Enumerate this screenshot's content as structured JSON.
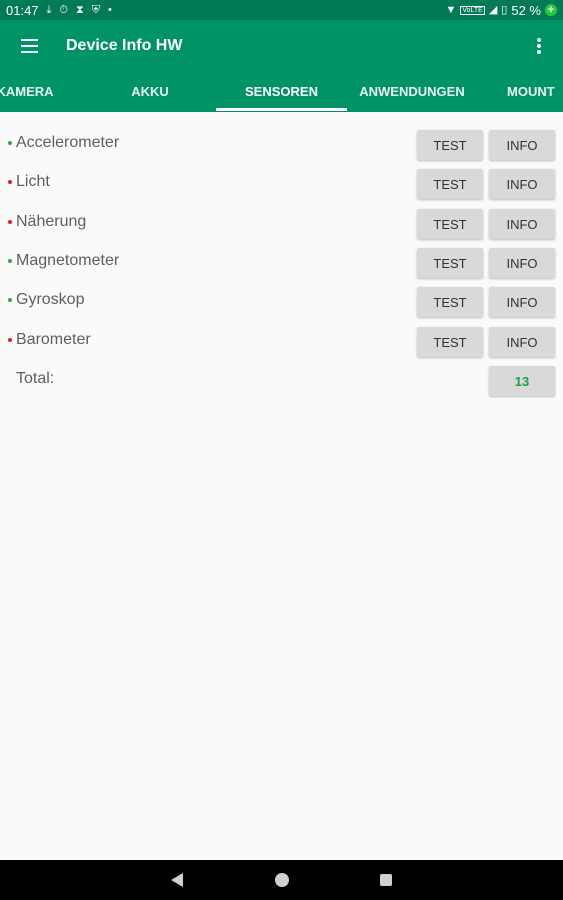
{
  "status_bar": {
    "time": "01:47",
    "left_icons": [
      "download-icon",
      "timer-icon",
      "hourglass-icon",
      "shield-icon",
      "dot-icon"
    ],
    "right_icons": [
      "wifi-icon",
      "volte-icon",
      "signal-icon",
      "battery-icon"
    ],
    "volte_label": "VoLTE",
    "battery": "52 %"
  },
  "app_bar": {
    "title": "Device Info HW"
  },
  "tabs": [
    {
      "label": "KAMERA",
      "active": false
    },
    {
      "label": "AKKU",
      "active": false
    },
    {
      "label": "SENSOREN",
      "active": true
    },
    {
      "label": "ANWENDUNGEN",
      "active": false
    },
    {
      "label": "MOUNT",
      "active": false
    }
  ],
  "sensors": [
    {
      "name": "Accelerometer",
      "dot_color": "#2eaa4a",
      "test_label": "TEST",
      "info_label": "INFO"
    },
    {
      "name": "Licht",
      "dot_color": "#e02020",
      "test_label": "TEST",
      "info_label": "INFO"
    },
    {
      "name": "Näherung",
      "dot_color": "#e02020",
      "test_label": "TEST",
      "info_label": "INFO"
    },
    {
      "name": "Magnetometer",
      "dot_color": "#2eaa4a",
      "test_label": "TEST",
      "info_label": "INFO"
    },
    {
      "name": "Gyroskop",
      "dot_color": "#2eaa4a",
      "test_label": "TEST",
      "info_label": "INFO"
    },
    {
      "name": "Barometer",
      "dot_color": "#e02020",
      "test_label": "TEST",
      "info_label": "INFO"
    }
  ],
  "total": {
    "label": "Total:",
    "value": "13"
  },
  "colors": {
    "status_bar": "#007a57",
    "app_bar": "#009368",
    "active_dot": "#2eaa4a",
    "inactive_dot": "#e02020"
  }
}
